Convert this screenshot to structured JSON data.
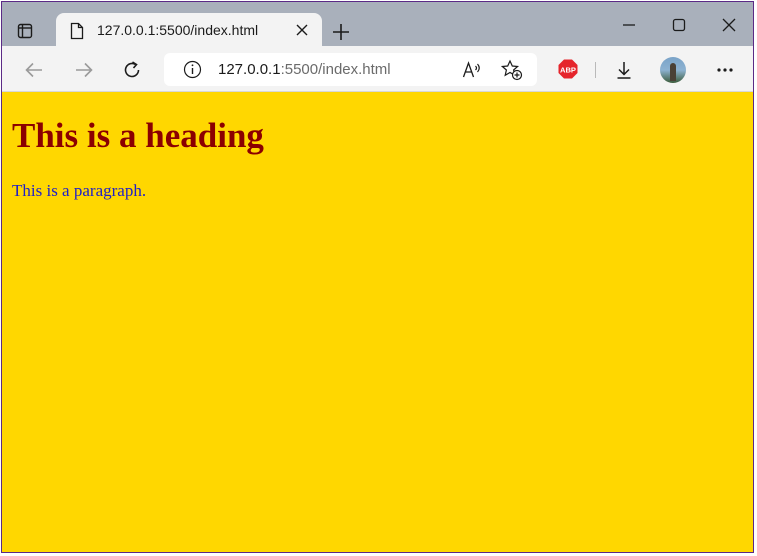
{
  "browser": {
    "tab": {
      "title": "127.0.0.1:5500/index.html"
    },
    "address_bar": {
      "host": "127.0.0.1",
      "rest": ":5500/index.html"
    }
  },
  "page": {
    "heading": "This is a heading",
    "paragraph": "This is a paragraph.",
    "background_color": "#ffd700",
    "heading_color": "#8b0000",
    "paragraph_color": "#2020c8"
  },
  "icons": {
    "tab_actions": "tab-actions-icon",
    "favicon": "document-icon",
    "close_tab": "close-icon",
    "new_tab": "plus-icon",
    "minimize": "minimize-icon",
    "maximize": "maximize-icon",
    "close_window": "close-window-icon",
    "back": "back-arrow-icon",
    "forward": "forward-arrow-icon",
    "refresh": "refresh-icon",
    "site_info": "info-icon",
    "read_aloud": "read-aloud-icon",
    "favorites": "add-favorite-icon",
    "adblock": "adblock-plus-icon",
    "downloads": "download-icon",
    "profile": "avatar",
    "menu": "more-icon"
  }
}
